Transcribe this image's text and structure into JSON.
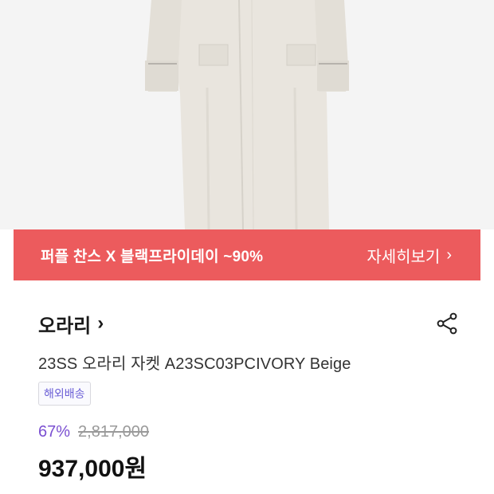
{
  "promo": {
    "title": "퍼플 찬스 X 블랙프라이데이 ~90%",
    "link_label": "자세히보기",
    "link_chevron": "›"
  },
  "brand": {
    "name": "오라리",
    "chevron": "›",
    "share_icon": "share-icon"
  },
  "product": {
    "name": "23SS 오라리 자켓 A23SC03PCIVORY Beige",
    "shipping_badge": "해외배송",
    "discount_rate": "67%",
    "original_price": "2,817,000",
    "sale_price": "937,000원"
  },
  "colors": {
    "promo_bg": "#ec5b5d",
    "discount": "#7a4fd1",
    "badge_text": "#6b5fd6"
  }
}
